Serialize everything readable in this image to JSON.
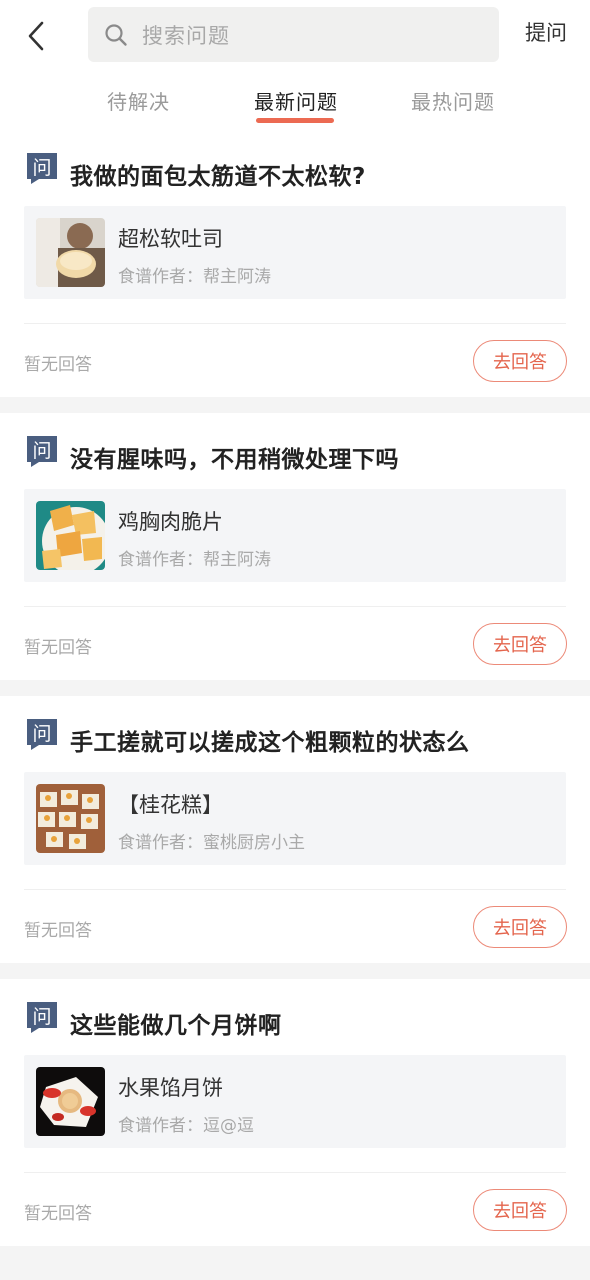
{
  "header": {
    "back_icon": "chevron-left-icon",
    "search": {
      "icon": "search-icon",
      "placeholder": "搜索问题"
    },
    "ask_label": "提问"
  },
  "tabs": [
    {
      "label": "待解决",
      "active": false
    },
    {
      "label": "最新问题",
      "active": true
    },
    {
      "label": "最热问题",
      "active": false
    }
  ],
  "colors": {
    "accent": "#ec6a52",
    "badge": "#4a5e80",
    "card_bg": "#ffffff",
    "page_bg": "#f4f4f4"
  },
  "questions": [
    {
      "badge": "问",
      "title": "我做的面包太筋道不太松软?",
      "recipe": {
        "name": "超松软吐司",
        "author": "食谱作者：帮主阿涛",
        "thumb": "bread-photo"
      },
      "status": "暂无回答",
      "answer_label": "去回答"
    },
    {
      "badge": "问",
      "title": "没有腥味吗，不用稍微处理下吗",
      "recipe": {
        "name": "鸡胸肉脆片",
        "author": "食谱作者：帮主阿涛",
        "thumb": "chips-photo"
      },
      "status": "暂无回答",
      "answer_label": "去回答"
    },
    {
      "badge": "问",
      "title": "手工搓就可以搓成这个粗颗粒的状态么",
      "recipe": {
        "name": "【桂花糕】",
        "author": "食谱作者：蜜桃厨房小主",
        "thumb": "cake-photo"
      },
      "status": "暂无回答",
      "answer_label": "去回答"
    },
    {
      "badge": "问",
      "title": "这些能做几个月饼啊",
      "recipe": {
        "name": "水果馅月饼",
        "author": "食谱作者：逗@逗",
        "thumb": "mooncake-photo"
      },
      "status": "暂无回答",
      "answer_label": "去回答"
    }
  ]
}
